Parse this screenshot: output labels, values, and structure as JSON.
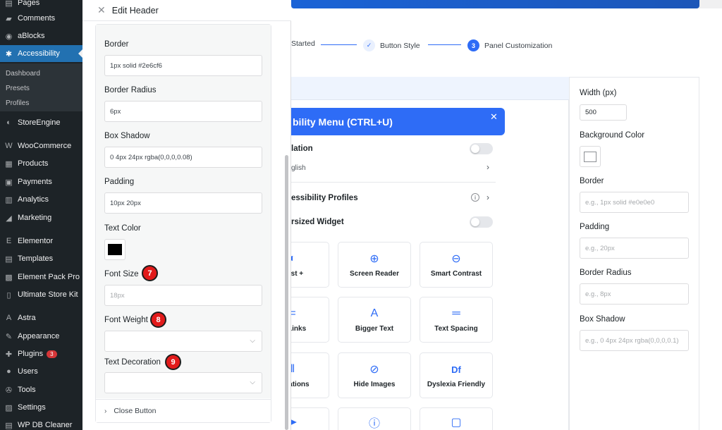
{
  "wp_menu": {
    "items": [
      {
        "label": "Pages",
        "icon": "pages-icon",
        "glyph": "▤"
      },
      {
        "label": "Comments",
        "icon": "comments-icon",
        "glyph": "▰"
      },
      {
        "label": "aBlocks",
        "icon": "ablocks-icon",
        "glyph": "◉"
      },
      {
        "label": "Accessibility",
        "icon": "accessibility-icon",
        "glyph": "✱"
      },
      {
        "label": "StoreEngine",
        "icon": "storeengine-icon",
        "glyph": "◐"
      },
      {
        "label": "WooCommerce",
        "icon": "woocommerce-icon",
        "glyph": "W"
      },
      {
        "label": "Products",
        "icon": "products-icon",
        "glyph": "▦"
      },
      {
        "label": "Payments",
        "icon": "payments-icon",
        "glyph": "▣"
      },
      {
        "label": "Analytics",
        "icon": "analytics-icon",
        "glyph": "▥"
      },
      {
        "label": "Marketing",
        "icon": "marketing-icon",
        "glyph": "◢"
      },
      {
        "label": "Elementor",
        "icon": "elementor-icon",
        "glyph": "E"
      },
      {
        "label": "Templates",
        "icon": "templates-icon",
        "glyph": "▤"
      },
      {
        "label": "Element Pack Pro",
        "icon": "element-pack-icon",
        "glyph": "▩"
      },
      {
        "label": "Ultimate Store Kit",
        "icon": "store-kit-icon",
        "glyph": "▯"
      },
      {
        "label": "Astra",
        "icon": "astra-icon",
        "glyph": "A"
      },
      {
        "label": "Appearance",
        "icon": "appearance-icon",
        "glyph": "✎"
      },
      {
        "label": "Plugins",
        "icon": "plugins-icon",
        "glyph": "✚",
        "badge": "3"
      },
      {
        "label": "Users",
        "icon": "users-icon",
        "glyph": "●"
      },
      {
        "label": "Tools",
        "icon": "tools-icon",
        "glyph": "✇"
      },
      {
        "label": "Settings",
        "icon": "settings-icon",
        "glyph": "▨"
      },
      {
        "label": "WP DB Cleaner",
        "icon": "db-cleaner-icon",
        "glyph": "▤"
      }
    ],
    "submenu": [
      "Dashboard",
      "Presets",
      "Profiles"
    ]
  },
  "edit_panel": {
    "title": "Edit Header",
    "fields": {
      "border": {
        "label": "Border",
        "value": "1px solid #2e6cf6"
      },
      "border_radius": {
        "label": "Border Radius",
        "value": "6px"
      },
      "box_shadow": {
        "label": "Box Shadow",
        "value": "0 4px 24px rgba(0,0,0,0.08)"
      },
      "padding": {
        "label": "Padding",
        "value": "10px 20px"
      },
      "text_color": {
        "label": "Text Color",
        "value": "#000000"
      },
      "font_size": {
        "label": "Font Size",
        "placeholder": "18px",
        "step": "7"
      },
      "font_weight": {
        "label": "Font Weight",
        "value": "",
        "step": "8"
      },
      "text_decoration": {
        "label": "Text Decoration",
        "value": "",
        "step": "9"
      }
    },
    "close_button_section": "Close Button"
  },
  "steps": [
    {
      "label": "Started",
      "state": "done"
    },
    {
      "label": "Button Style",
      "state": "done"
    },
    {
      "label": "Panel Customization",
      "number": "3",
      "state": "current"
    }
  ],
  "widget_preview": {
    "header_title": "bility Menu (CTRL+U)",
    "rows": {
      "translation": "lation",
      "language": "glish",
      "profiles": "essibility Profiles",
      "oversized": "rsized Widget"
    },
    "tiles": [
      {
        "label": "trast +",
        "glyph": "◐",
        "icon": "contrast-icon"
      },
      {
        "label": "Screen Reader",
        "glyph": "⊕",
        "icon": "screen-reader-icon"
      },
      {
        "label": "Smart Contrast",
        "glyph": "⊖",
        "icon": "smart-contrast-icon"
      },
      {
        "label": "ht Links",
        "glyph": "=",
        "icon": "highlight-links-icon"
      },
      {
        "label": "Bigger Text",
        "glyph": "A",
        "icon": "bigger-text-icon"
      },
      {
        "label": "Text Spacing",
        "glyph": "═",
        "icon": "text-spacing-icon"
      },
      {
        "label": "nimations",
        "glyph": "‖",
        "icon": "pause-animations-icon"
      },
      {
        "label": "Hide Images",
        "glyph": "⊘",
        "icon": "hide-images-icon"
      },
      {
        "label": "Dyslexia Friendly",
        "glyph": "Df",
        "icon": "dyslexia-icon"
      },
      {
        "label": "",
        "glyph": "➤",
        "icon": "cursor-icon"
      },
      {
        "label": "",
        "glyph": "ⓘ",
        "icon": "info-icon"
      },
      {
        "label": "",
        "glyph": "▢",
        "icon": "square-icon"
      }
    ]
  },
  "right_panel": {
    "width": {
      "label": "Width (px)",
      "value": "500"
    },
    "background_color": {
      "label": "Background Color"
    },
    "border": {
      "label": "Border",
      "placeholder": "e.g., 1px solid #e0e0e0"
    },
    "padding": {
      "label": "Padding",
      "placeholder": "e.g., 20px"
    },
    "border_radius": {
      "label": "Border Radius",
      "placeholder": "e.g., 8px"
    },
    "box_shadow": {
      "label": "Box Shadow",
      "placeholder": "e.g., 0 4px 24px rgba(0,0,0,0.1)"
    }
  },
  "colors": {
    "accent": "#2e6cf6",
    "wp_sidebar": "#1d2327",
    "wp_active": "#2271b1",
    "badge_red": "#e21b1b"
  }
}
